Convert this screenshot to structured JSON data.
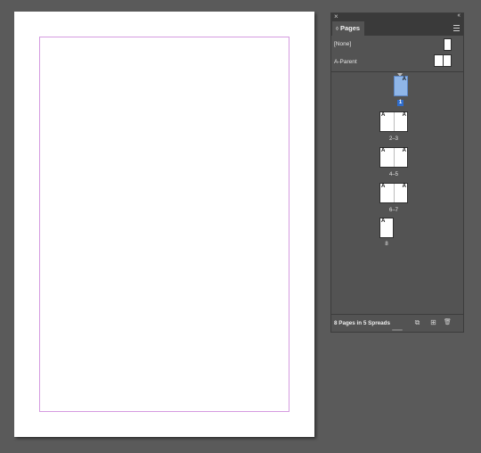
{
  "panel": {
    "tab_label": "Pages",
    "tab_arrows": "◊",
    "close_glyph": "×",
    "collapse_glyph": "‹‹",
    "parents": [
      {
        "label": "[None]"
      },
      {
        "label": "A-Parent"
      }
    ],
    "spreads": [
      {
        "label": "1",
        "pages": 1,
        "selected": true
      },
      {
        "label": "2–3",
        "pages": 2
      },
      {
        "label": "4–5",
        "pages": 2
      },
      {
        "label": "6–7",
        "pages": 2
      },
      {
        "label": "8",
        "pages": 1
      }
    ],
    "parent_letter": "A",
    "footer_status": "8 Pages in 5 Spreads",
    "footer_buttons": {
      "edit_page_size": "⧉",
      "new_page": "⊞",
      "delete": "🗑"
    }
  },
  "colors": {
    "pasteboard": "#5a5a5a",
    "panel_bg": "#535353",
    "margin_guide": "#d59be0",
    "selection": "#8fb6e8",
    "badge": "#2f6dcc"
  }
}
